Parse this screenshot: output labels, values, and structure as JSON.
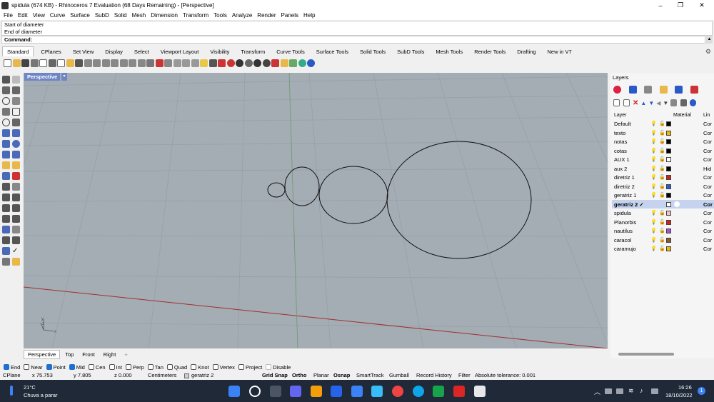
{
  "window": {
    "title": "spidula (674 KB) - Rhinoceros 7 Evaluation (68 Days Remaining) - [Perspective]",
    "minimize": "–",
    "maximize": "❐",
    "close": "✕"
  },
  "menu": [
    "File",
    "Edit",
    "View",
    "Curve",
    "Surface",
    "SubD",
    "Solid",
    "Mesh",
    "Dimension",
    "Transform",
    "Tools",
    "Analyze",
    "Render",
    "Panels",
    "Help"
  ],
  "history": [
    "Start of diameter",
    "End of diameter"
  ],
  "command": {
    "label": "Command:",
    "value": ""
  },
  "toolbar_tabs": [
    "Standard",
    "CPlanes",
    "Set View",
    "Display",
    "Select",
    "Viewport Layout",
    "Visibility",
    "Transform",
    "Curve Tools",
    "Surface Tools",
    "Solid Tools",
    "SubD Tools",
    "Mesh Tools",
    "Render Tools",
    "Drafting",
    "New in V7"
  ],
  "viewport": {
    "label": "Perspective",
    "axis_x": "x",
    "axis_y": "y",
    "axis_z": "z"
  },
  "viewport_tabs": [
    "Perspective",
    "Top",
    "Front",
    "Right"
  ],
  "viewport_add": "+",
  "panel": {
    "title": "Layers",
    "columns": {
      "layer": "Layer",
      "material": "Material",
      "linetype": "Lin"
    },
    "layers": [
      {
        "name": "Default",
        "color": "#000000",
        "mat": "Cor"
      },
      {
        "name": "texto",
        "color": "#f2b705",
        "mat": "Cor"
      },
      {
        "name": "notas",
        "color": "#000000",
        "mat": "Cor"
      },
      {
        "name": "cotas",
        "color": "#000000",
        "mat": "Cor"
      },
      {
        "name": "AUX 1",
        "color": "#ffffff",
        "mat": "Cor"
      },
      {
        "name": "aux 2",
        "color": "#000000",
        "mat": "Hid"
      },
      {
        "name": "diretriz 1",
        "color": "#d21f1f",
        "mat": "Cor"
      },
      {
        "name": "diretriz 2",
        "color": "#1f5fd2",
        "mat": "Cor"
      },
      {
        "name": "geratriz 1",
        "color": "#000000",
        "mat": "Cor"
      },
      {
        "name": "geratriz 2 ✓",
        "color": "#ffffff",
        "mat": "Cor"
      },
      {
        "name": "spidula",
        "color": "#f2c4c4",
        "mat": "Cor"
      },
      {
        "name": "Planorbis",
        "color": "#d21f1f",
        "mat": "Cor"
      },
      {
        "name": "nautilus",
        "color": "#a64fd2",
        "mat": "Cor"
      },
      {
        "name": "caracol",
        "color": "#8a5a2b",
        "mat": "Cor"
      },
      {
        "name": "caramujo",
        "color": "#f2b705",
        "mat": "Cor"
      }
    ]
  },
  "osnaps": [
    {
      "label": "End",
      "on": true
    },
    {
      "label": "Near",
      "on": false
    },
    {
      "label": "Point",
      "on": true
    },
    {
      "label": "Mid",
      "on": true
    },
    {
      "label": "Cen",
      "on": false
    },
    {
      "label": "Int",
      "on": false
    },
    {
      "label": "Perp",
      "on": false
    },
    {
      "label": "Tan",
      "on": false
    },
    {
      "label": "Quad",
      "on": false
    },
    {
      "label": "Knot",
      "on": false
    },
    {
      "label": "Vertex",
      "on": false
    },
    {
      "label": "Project",
      "on": false
    },
    {
      "label": "Disable",
      "on": false
    }
  ],
  "status": {
    "cplane": "CPlane",
    "x": "x 75.753",
    "y": "y 7.805",
    "z": "z 0.000",
    "units": "Centimeters",
    "layer": "geratriz 2",
    "grid_snap": "Grid Snap",
    "ortho": "Ortho",
    "planar": "Planar",
    "osnap": "Osnap",
    "smarttrack": "SmartTrack",
    "gumball": "Gumball",
    "record_history": "Record History",
    "filter": "Filter",
    "tolerance": "Absolute tolerance: 0.001"
  },
  "taskbar": {
    "weather_temp": "21°C",
    "weather_desc": "Chuva a parar",
    "time": "16:26",
    "date": "18/10/2022",
    "notification_count": "1"
  }
}
